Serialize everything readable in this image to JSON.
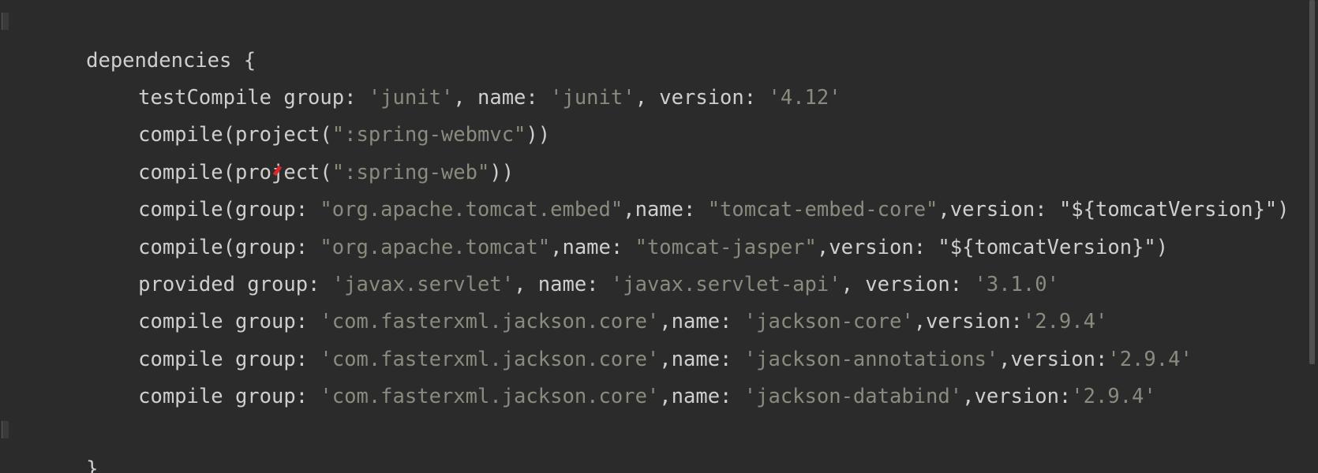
{
  "editor": {
    "lines": [
      {
        "segments": [
          {
            "t": "dependencies {",
            "k": "plain"
          }
        ]
      },
      {
        "segments": [
          {
            "t": "testCompile group: ",
            "k": "plain"
          },
          {
            "t": "'junit'",
            "k": "str"
          },
          {
            "t": ", name: ",
            "k": "plain"
          },
          {
            "t": "'junit'",
            "k": "str"
          },
          {
            "t": ", version: ",
            "k": "plain"
          },
          {
            "t": "'4.12'",
            "k": "str"
          }
        ]
      },
      {
        "segments": [
          {
            "t": "compile(project(",
            "k": "plain"
          },
          {
            "t": "\":spring-webmvc\"",
            "k": "str"
          },
          {
            "t": "))",
            "k": "plain"
          }
        ]
      },
      {
        "segments": [
          {
            "t": "compile(project(",
            "k": "plain"
          },
          {
            "t": "\":spring-web\"",
            "k": "str"
          },
          {
            "t": "))",
            "k": "plain"
          }
        ]
      },
      {
        "segments": [
          {
            "t": "compile(group: ",
            "k": "plain"
          },
          {
            "t": "\"org.apache.tomcat.embed\"",
            "k": "str"
          },
          {
            "t": ",name: ",
            "k": "plain"
          },
          {
            "t": "\"tomcat-embed-core\"",
            "k": "str"
          },
          {
            "t": ",version: ",
            "k": "plain"
          },
          {
            "t": "\"${tomcatVersion}\"",
            "k": "plain"
          },
          {
            "t": ")",
            "k": "plain"
          }
        ]
      },
      {
        "segments": [
          {
            "t": "compile(group: ",
            "k": "plain"
          },
          {
            "t": "\"org.apache.tomcat\"",
            "k": "str"
          },
          {
            "t": ",name: ",
            "k": "plain"
          },
          {
            "t": "\"tomcat-jasper\"",
            "k": "str"
          },
          {
            "t": ",version: ",
            "k": "plain"
          },
          {
            "t": "\"${tomcatVersion}\"",
            "k": "plain"
          },
          {
            "t": ")",
            "k": "plain"
          }
        ]
      },
      {
        "segments": [
          {
            "t": "provided group: ",
            "k": "plain"
          },
          {
            "t": "'javax.servlet'",
            "k": "str"
          },
          {
            "t": ", name: ",
            "k": "plain"
          },
          {
            "t": "'javax.servlet-api'",
            "k": "str"
          },
          {
            "t": ", version: ",
            "k": "plain"
          },
          {
            "t": "'3.1.0'",
            "k": "str"
          }
        ]
      },
      {
        "segments": [
          {
            "t": "compile group: ",
            "k": "plain"
          },
          {
            "t": "'com.fasterxml.jackson.core'",
            "k": "str"
          },
          {
            "t": ",name: ",
            "k": "plain"
          },
          {
            "t": "'jackson-core'",
            "k": "str"
          },
          {
            "t": ",version:",
            "k": "plain"
          },
          {
            "t": "'2.9.4'",
            "k": "str"
          }
        ]
      },
      {
        "segments": [
          {
            "t": "compile group: ",
            "k": "plain"
          },
          {
            "t": "'com.fasterxml.jackson.core'",
            "k": "str"
          },
          {
            "t": ",name: ",
            "k": "plain"
          },
          {
            "t": "'jackson-annotations'",
            "k": "str"
          },
          {
            "t": ",version:",
            "k": "plain"
          },
          {
            "t": "'2.9.4'",
            "k": "str"
          }
        ]
      },
      {
        "segments": [
          {
            "t": "compile group: ",
            "k": "plain"
          },
          {
            "t": "'com.fasterxml.jackson.core'",
            "k": "str"
          },
          {
            "t": ",name: ",
            "k": "plain"
          },
          {
            "t": "'jackson-databind'",
            "k": "str"
          },
          {
            "t": ",version:",
            "k": "plain"
          },
          {
            "t": "'2.9.4'",
            "k": "str"
          }
        ]
      },
      {
        "segments": []
      },
      {
        "segments": [
          {
            "t": "}",
            "k": "plain"
          }
        ]
      }
    ]
  },
  "colors": {
    "background": "#2b2b2b",
    "text": "#cfcfcf",
    "string": "#8a8a7e",
    "error_mark": "#d8262b"
  }
}
